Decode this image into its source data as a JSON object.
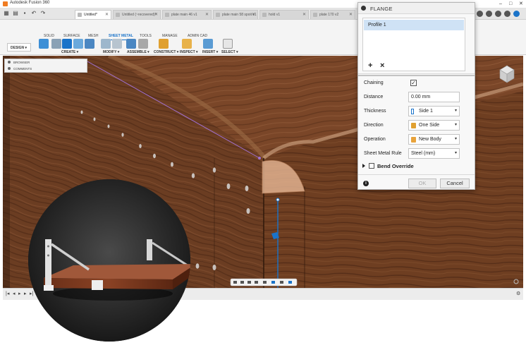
{
  "window": {
    "title": "Autodesk Fusion 360"
  },
  "tabs": [
    {
      "label": "Untitled*",
      "active": true
    },
    {
      "label": "Untitled (~recovered)*",
      "active": false
    },
    {
      "label": "plate main 46 v1",
      "active": false
    },
    {
      "label": "plate main 58 spoit v1",
      "active": false
    },
    {
      "label": "hold v1",
      "active": false
    },
    {
      "label": "plate 170 v2",
      "active": false
    }
  ],
  "workspace_tabs": [
    "SOLID",
    "SURFACE",
    "MESH",
    "SHEET METAL",
    "TOOLS",
    "MANAGE",
    "ADMIN CAD"
  ],
  "toolbar": {
    "design_label": "DESIGN ▾",
    "groups": [
      "CREATE ▾",
      "MODIFY ▾",
      "ASSEMBLE ▾",
      "CONSTRUCT ▾",
      "INSPECT ▾",
      "INSERT ▾",
      "SELECT ▾"
    ]
  },
  "browser": {
    "rows": [
      "BROWSER",
      "COMMENTS"
    ]
  },
  "flange": {
    "title": "FLANGE",
    "profile_item": "Profile 1",
    "add": "+",
    "remove": "×",
    "fields": {
      "chaining": {
        "label": "Chaining",
        "checked": true
      },
      "distance": {
        "label": "Distance",
        "value": "0.00 mm"
      },
      "thickness": {
        "label": "Thickness",
        "value": "Side 1"
      },
      "direction": {
        "label": "Direction",
        "value": "One Side"
      },
      "operation": {
        "label": "Operation",
        "value": "New Body"
      },
      "rule": {
        "label": "Sheet Metal Rule",
        "value": "Steel (mm)"
      }
    },
    "bend_override": "Bend Override",
    "ok": "OK",
    "cancel": "Cancel",
    "info": "i"
  },
  "colors": {
    "accent": "#1a73c9",
    "wood_dark": "#4a2716",
    "wood_mid": "#7a4a2c",
    "selection": "#e8b896",
    "sketch_line": "#a070d0"
  }
}
